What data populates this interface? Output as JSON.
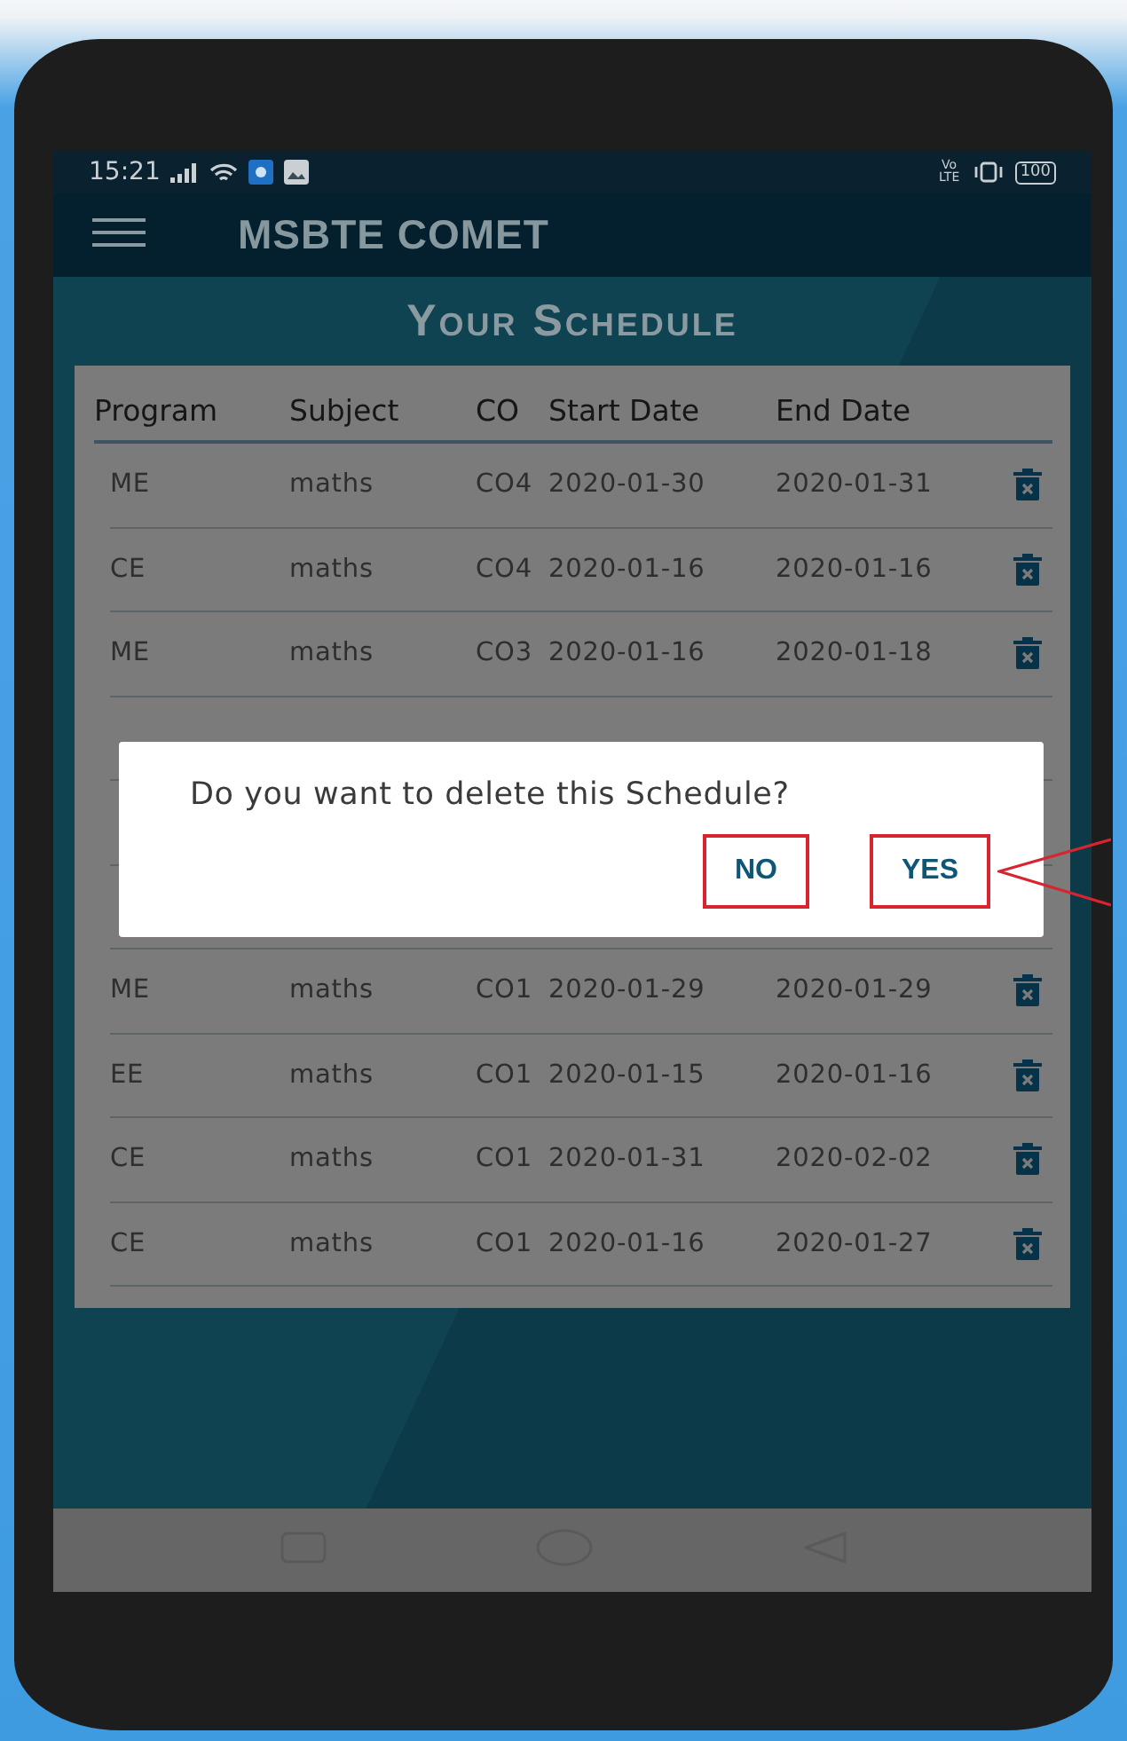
{
  "status_bar": {
    "time": "15:21",
    "network_label": "Vo LTE",
    "battery": "100"
  },
  "app_bar": {
    "title": "MSBTE COMET"
  },
  "page_title": "Your Schedule",
  "table": {
    "columns": [
      "Program",
      "Subject",
      "CO",
      "Start Date",
      "End Date"
    ],
    "rows": [
      {
        "kind": "full",
        "program": "ME",
        "subject": "maths",
        "co": "CO4",
        "start": "2020-01-30",
        "end": "2020-01-31"
      },
      {
        "kind": "full",
        "program": "CE",
        "subject": "maths",
        "co": "CO4",
        "start": "2020-01-16",
        "end": "2020-01-16"
      },
      {
        "kind": "full",
        "program": "ME",
        "subject": "maths",
        "co": "CO3",
        "start": "2020-01-16",
        "end": "2020-01-18"
      },
      {
        "kind": "covered"
      },
      {
        "kind": "covered"
      },
      {
        "kind": "covered"
      },
      {
        "kind": "full",
        "program": "ME",
        "subject": "maths",
        "co": "CO1",
        "start": "2020-01-29",
        "end": "2020-01-29"
      },
      {
        "kind": "full",
        "program": "EE",
        "subject": "maths",
        "co": "CO1",
        "start": "2020-01-15",
        "end": "2020-01-16"
      },
      {
        "kind": "full",
        "program": "CE",
        "subject": "maths",
        "co": "CO1",
        "start": "2020-01-31",
        "end": "2020-02-02"
      },
      {
        "kind": "full",
        "program": "CE",
        "subject": "maths",
        "co": "CO1",
        "start": "2020-01-16",
        "end": "2020-01-27"
      }
    ]
  },
  "dialog": {
    "message": "Do you want to delete this Schedule?",
    "buttons": [
      {
        "label": "NO",
        "highlighted": true
      },
      {
        "label": "YES",
        "highlighted": true,
        "pointed": true
      }
    ]
  }
}
